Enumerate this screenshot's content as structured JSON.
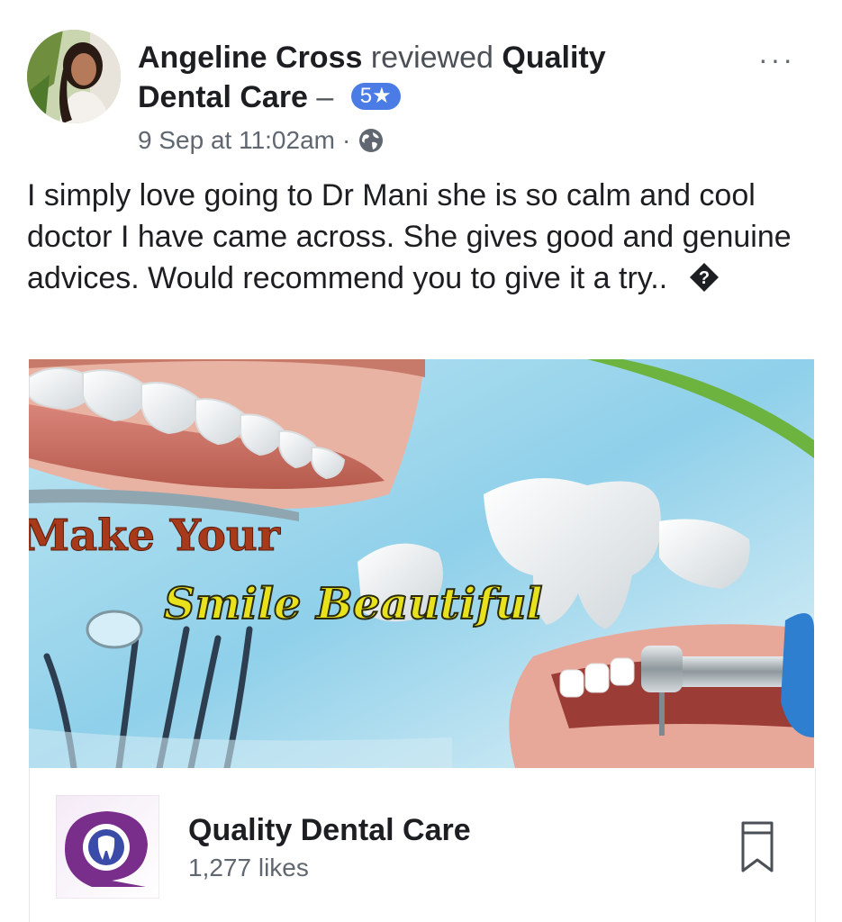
{
  "post": {
    "author": "Angeline Cross",
    "action": "reviewed",
    "page": "Quality Dental Care",
    "separator": "–",
    "rating_badge": "5★",
    "timestamp": "9 Sep at 11:02am",
    "dot": "·",
    "privacy_icon": "globe-icon",
    "more_label": "···",
    "text": "I simply love going to Dr Mani she is so calm and cool doctor I have came across. She gives good and genuine advices. Would recommend you to give it a try..",
    "emoji_icon": "unknown-glyph-icon"
  },
  "image": {
    "headline": "Make Your",
    "tagline": "Smile Beautiful"
  },
  "page_card": {
    "name": "Quality Dental Care",
    "likes": "1,277 likes",
    "bookmark_icon": "bookmark-icon"
  },
  "colors": {
    "badge": "#4b7ce5",
    "headline": "#a63a1a",
    "tagline": "#e8e21c",
    "logo_purple": "#7a2e8c"
  }
}
